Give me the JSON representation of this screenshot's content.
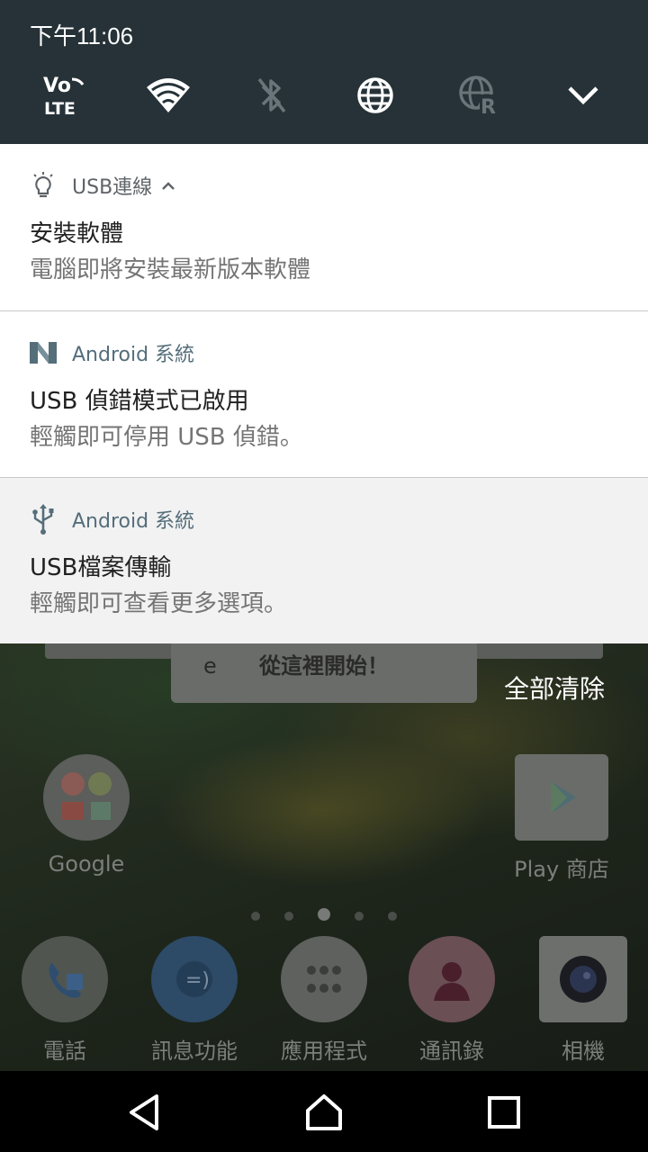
{
  "status_bar": {
    "time": "下午11:06"
  },
  "quick_settings": {
    "tiles": [
      {
        "icon": "volte-lte-icon",
        "label": "LTE",
        "prefix": "Vo",
        "state": "on"
      },
      {
        "icon": "wifi-icon",
        "state": "on"
      },
      {
        "icon": "bluetooth-icon",
        "state": "off"
      },
      {
        "icon": "globe-icon",
        "state": "on"
      },
      {
        "icon": "roaming-globe-icon",
        "badge": "R",
        "state": "off"
      },
      {
        "icon": "expand-chevron-icon"
      }
    ]
  },
  "notifications": [
    {
      "app_icon": "lightbulb-icon",
      "app_name": "USB連線",
      "expand_icon": "chevron-up-icon",
      "title": "安裝軟體",
      "body": "電腦即將安裝最新版本軟體"
    },
    {
      "app_icon": "android-n-icon",
      "app_name": "Android 系統",
      "title": "USB 偵錯模式已啟用",
      "body": "輕觸即可停用 USB 偵錯。"
    },
    {
      "app_icon": "usb-icon",
      "app_name": "Android 系統",
      "title": "USB檔案傳輸",
      "body": "輕觸即可查看更多選項。"
    }
  ],
  "clear_all_label": "全部清除",
  "home_screen": {
    "widget_text": "從這裡開始！",
    "widget_glyph": "e",
    "apps_top": [
      {
        "label": "Google",
        "icon": "google-folder-icon"
      },
      {
        "label": "Play 商店",
        "icon": "play-store-icon"
      }
    ],
    "dock": [
      {
        "label": "電話",
        "icon": "phone-icon"
      },
      {
        "label": "訊息功能",
        "icon": "messaging-icon"
      },
      {
        "label": "應用程式",
        "icon": "app-drawer-icon"
      },
      {
        "label": "通訊錄",
        "icon": "contacts-icon"
      },
      {
        "label": "相機",
        "icon": "camera-icon"
      }
    ],
    "page_indicator": {
      "count": 5,
      "active": 3
    }
  },
  "nav_bar": {
    "buttons": [
      "back-icon",
      "home-icon",
      "recents-icon"
    ]
  },
  "colors": {
    "shade": "#263238",
    "accent_text": "#546e7a",
    "notification_bg": "#ffffff"
  }
}
